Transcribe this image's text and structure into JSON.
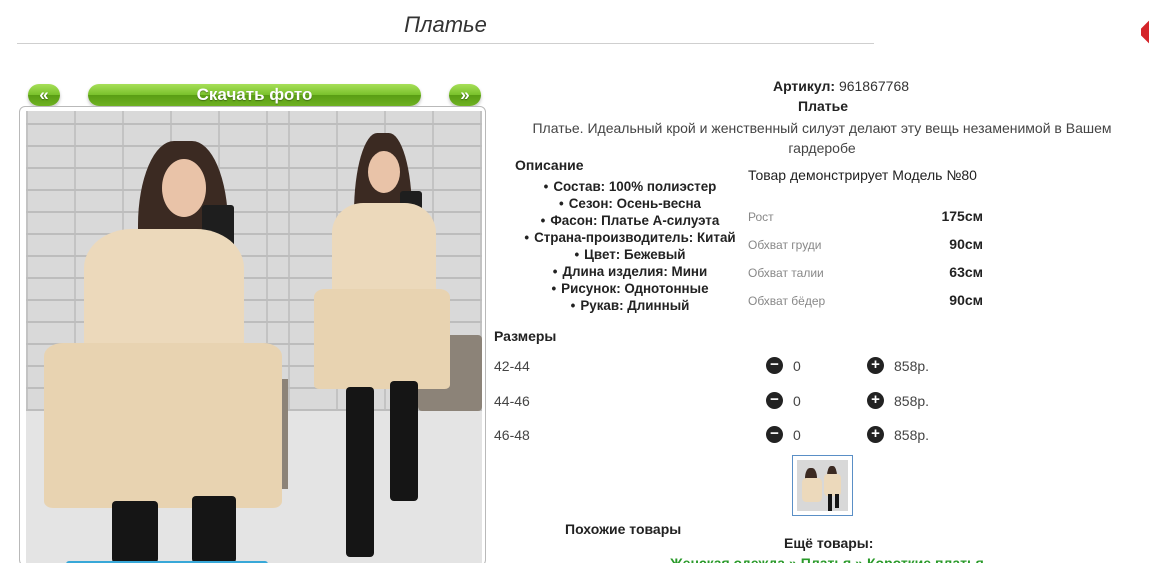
{
  "page": {
    "title": "Платье"
  },
  "gallery": {
    "prev_label": "«",
    "download_label": "Скачать фото",
    "next_label": "»"
  },
  "product": {
    "article_label": "Артикул:",
    "article_value": "961867768",
    "name": "Платье",
    "description": "Платье. Идеальный крой и женственный силуэт делают эту вещь незаменимой в Вашем гардеробе"
  },
  "description_block": {
    "title": "Описание",
    "features": [
      "Состав: 100% полиэстер",
      "Сезон: Осень-весна",
      "Фасон: Платье А-силуэта",
      "Страна-производитель: Китай",
      "Цвет: Бежевый",
      "Длина изделия: Мини",
      "Рисунок: Однотонные",
      "Рукав: Длинный"
    ]
  },
  "model": {
    "line": "Товар демонстрирует Модель №80",
    "measurements": [
      {
        "label": "Рост",
        "value": "175см"
      },
      {
        "label": "Обхват груди",
        "value": "90см"
      },
      {
        "label": "Обхват талии",
        "value": "63см"
      },
      {
        "label": "Обхват бёдер",
        "value": "90см"
      }
    ]
  },
  "sizes": {
    "title": "Размеры",
    "rows": [
      {
        "size": "42-44",
        "minus": "−",
        "qty": "0",
        "plus": "+",
        "price": "858р."
      },
      {
        "size": "44-46",
        "minus": "−",
        "qty": "0",
        "plus": "+",
        "price": "858р."
      },
      {
        "size": "46-48",
        "minus": "−",
        "qty": "0",
        "plus": "+",
        "price": "858р."
      }
    ]
  },
  "similar": {
    "title": "Похожие товары"
  },
  "more": {
    "title": "Ещё товары:",
    "crumbs": [
      "Женская одежда",
      "Платья",
      "Короткие платья"
    ],
    "separator": "»"
  },
  "icons": {
    "minus": "minus-circle-icon",
    "plus": "plus-circle-icon"
  },
  "colors": {
    "button_green": "#79c12b",
    "link_green": "#2a9a2a",
    "dress_beige": "#ecd9bb"
  }
}
